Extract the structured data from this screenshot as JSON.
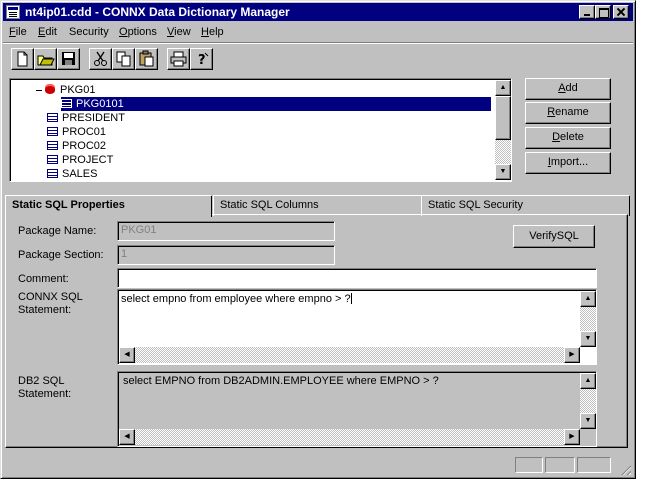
{
  "window": {
    "title": "nt4ip01.cdd - CONNX Data Dictionary Manager"
  },
  "menu": [
    {
      "label": "File",
      "mnemonic": "F",
      "rest": "ile"
    },
    {
      "label": "Edit",
      "mnemonic": "E",
      "rest": "dit"
    },
    {
      "label": "Security",
      "mnemonic": "",
      "rest": "Security"
    },
    {
      "label": "Options",
      "mnemonic": "O",
      "rest": "ptions"
    },
    {
      "label": "View",
      "mnemonic": "V",
      "rest": "iew"
    },
    {
      "label": "Help",
      "mnemonic": "H",
      "rest": "elp"
    }
  ],
  "toolbar": {
    "icons": [
      "new-icon",
      "open-icon",
      "save-icon",
      "cut-icon",
      "copy-icon",
      "paste-icon",
      "print-icon",
      "help-icon"
    ]
  },
  "tree": {
    "items": [
      {
        "label": "PKG01",
        "type": "package",
        "expanded": true
      },
      {
        "label": "PKG0101",
        "type": "table",
        "selected": true
      },
      {
        "label": "PRESIDENT",
        "type": "table"
      },
      {
        "label": "PROC01",
        "type": "table"
      },
      {
        "label": "PROC02",
        "type": "table"
      },
      {
        "label": "PROJECT",
        "type": "table"
      },
      {
        "label": "SALES",
        "type": "table"
      }
    ]
  },
  "buttons": {
    "add": {
      "mnemonic": "A",
      "rest": "dd"
    },
    "rename": {
      "mnemonic": "R",
      "rest": "ename"
    },
    "delete": {
      "mnemonic": "D",
      "rest": "elete"
    },
    "import": {
      "mnemonic": "I",
      "rest": "mport..."
    }
  },
  "tabs": [
    {
      "label": "Static SQL Properties",
      "active": true
    },
    {
      "label": "Static SQL Columns",
      "active": false
    },
    {
      "label": "Static SQL Security",
      "active": false
    }
  ],
  "form": {
    "package_name_label": "Package Name:",
    "package_name_value": "PKG01",
    "package_section_label": "Package Section:",
    "package_section_value": "1",
    "verify_button": "VerifySQL",
    "comment_label": "Comment:",
    "comment_value": "",
    "connx_sql_label_1": "CONNX SQL",
    "connx_sql_label_2": "Statement:",
    "connx_sql_value": "select empno from employee where empno > ?",
    "db2_sql_label_1": "DB2 SQL",
    "db2_sql_label_2": "Statement:",
    "db2_sql_value": "select  EMPNO  from  DB2ADMIN.EMPLOYEE  where  EMPNO >  ?"
  },
  "colors": {
    "titlebar": "#000080",
    "face": "#c0c0c0",
    "selection": "#000080"
  }
}
